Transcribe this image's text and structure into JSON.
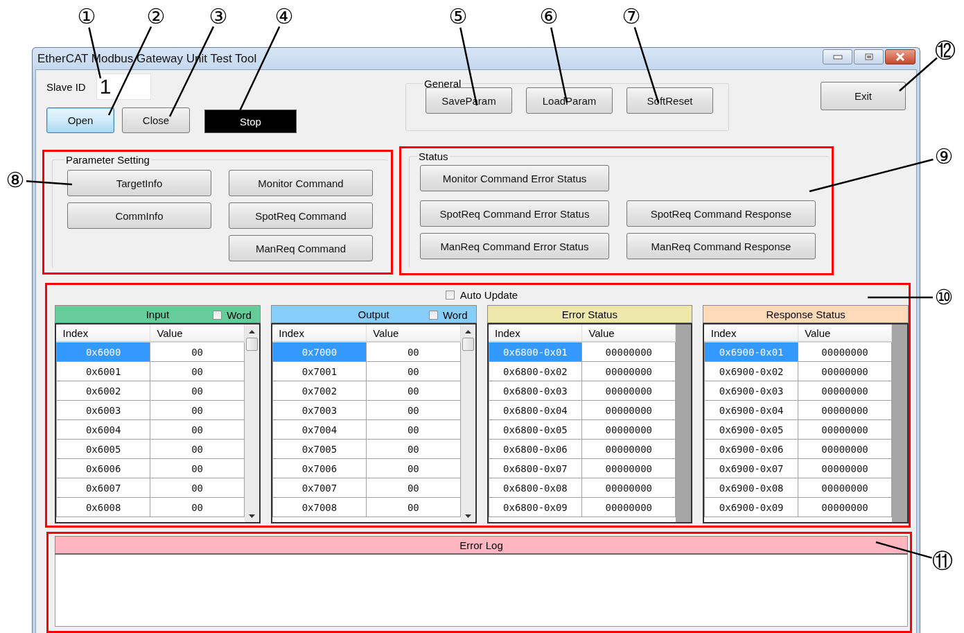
{
  "window": {
    "title": "EtherCAT Modbus Gateway Unit Test Tool"
  },
  "slave_id": {
    "label": "Slave ID",
    "value": "1"
  },
  "connection_buttons": [
    {
      "label": "Open",
      "kind": "default"
    },
    {
      "label": "Close",
      "kind": "normal"
    },
    {
      "label": "Stop",
      "kind": "indicator"
    }
  ],
  "general": {
    "title": "General",
    "buttons": [
      "SaveParam",
      "LoadParam",
      "SoftReset"
    ]
  },
  "exit_button": "Exit",
  "parameter_setting": {
    "title": "Parameter Setting",
    "columns": [
      [
        "TargetInfo",
        "CommInfo"
      ],
      [
        "Monitor Command",
        "SpotReq Command",
        "ManReq Command"
      ]
    ]
  },
  "status": {
    "title": "Status",
    "rows": [
      [
        "Monitor Command Error Status"
      ],
      [
        "SpotReq Command Error Status",
        "SpotReq Command Response"
      ],
      [
        "ManReq Command Error Status",
        "ManReq Command Response"
      ]
    ]
  },
  "auto_update": {
    "label": "Auto Update",
    "checked": false
  },
  "panels": [
    {
      "title": "Input",
      "color": "#66cc99",
      "kind": "scrollable",
      "word": {
        "label": "Word",
        "checked": false
      },
      "columns": [
        "Index",
        "Value"
      ],
      "rows": [
        {
          "index": "0x6000",
          "value": "00",
          "selected": true
        },
        {
          "index": "0x6001",
          "value": "00",
          "selected": false
        },
        {
          "index": "0x6002",
          "value": "00",
          "selected": false
        },
        {
          "index": "0x6003",
          "value": "00",
          "selected": false
        },
        {
          "index": "0x6004",
          "value": "00",
          "selected": false
        },
        {
          "index": "0x6005",
          "value": "00",
          "selected": false
        },
        {
          "index": "0x6006",
          "value": "00",
          "selected": false
        },
        {
          "index": "0x6007",
          "value": "00",
          "selected": false
        },
        {
          "index": "0x6008",
          "value": "00",
          "selected": false
        }
      ]
    },
    {
      "title": "Output",
      "color": "#87cefa",
      "kind": "scrollable",
      "word": {
        "label": "Word",
        "checked": false
      },
      "columns": [
        "Index",
        "Value"
      ],
      "rows": [
        {
          "index": "0x7000",
          "value": "00",
          "selected": true
        },
        {
          "index": "0x7001",
          "value": "00",
          "selected": false
        },
        {
          "index": "0x7002",
          "value": "00",
          "selected": false
        },
        {
          "index": "0x7003",
          "value": "00",
          "selected": false
        },
        {
          "index": "0x7004",
          "value": "00",
          "selected": false
        },
        {
          "index": "0x7005",
          "value": "00",
          "selected": false
        },
        {
          "index": "0x7006",
          "value": "00",
          "selected": false
        },
        {
          "index": "0x7007",
          "value": "00",
          "selected": false
        },
        {
          "index": "0x7008",
          "value": "00",
          "selected": false
        }
      ]
    },
    {
      "title": "Error Status",
      "color": "#eee8aa",
      "kind": "fixed",
      "columns": [
        "Index",
        "Value"
      ],
      "rows": [
        {
          "index": "0x6800-0x01",
          "value": "00000000",
          "selected": true
        },
        {
          "index": "0x6800-0x02",
          "value": "00000000",
          "selected": false
        },
        {
          "index": "0x6800-0x03",
          "value": "00000000",
          "selected": false
        },
        {
          "index": "0x6800-0x04",
          "value": "00000000",
          "selected": false
        },
        {
          "index": "0x6800-0x05",
          "value": "00000000",
          "selected": false
        },
        {
          "index": "0x6800-0x06",
          "value": "00000000",
          "selected": false
        },
        {
          "index": "0x6800-0x07",
          "value": "00000000",
          "selected": false
        },
        {
          "index": "0x6800-0x08",
          "value": "00000000",
          "selected": false
        },
        {
          "index": "0x6800-0x09",
          "value": "00000000",
          "selected": false
        }
      ]
    },
    {
      "title": "Response Status",
      "color": "#ffdab9",
      "kind": "fixed",
      "columns": [
        "Index",
        "Value"
      ],
      "rows": [
        {
          "index": "0x6900-0x01",
          "value": "00000000",
          "selected": true
        },
        {
          "index": "0x6900-0x02",
          "value": "00000000",
          "selected": false
        },
        {
          "index": "0x6900-0x03",
          "value": "00000000",
          "selected": false
        },
        {
          "index": "0x6900-0x04",
          "value": "00000000",
          "selected": false
        },
        {
          "index": "0x6900-0x05",
          "value": "00000000",
          "selected": false
        },
        {
          "index": "0x6900-0x06",
          "value": "00000000",
          "selected": false
        },
        {
          "index": "0x6900-0x07",
          "value": "00000000",
          "selected": false
        },
        {
          "index": "0x6900-0x08",
          "value": "00000000",
          "selected": false
        },
        {
          "index": "0x6900-0x09",
          "value": "00000000",
          "selected": false
        }
      ]
    }
  ],
  "error_log": {
    "title": "Error Log"
  },
  "callouts": [
    "①",
    "②",
    "③",
    "④",
    "⑤",
    "⑥",
    "⑦",
    "⑫",
    "⑧",
    "⑨",
    "⑩",
    "⑪"
  ]
}
